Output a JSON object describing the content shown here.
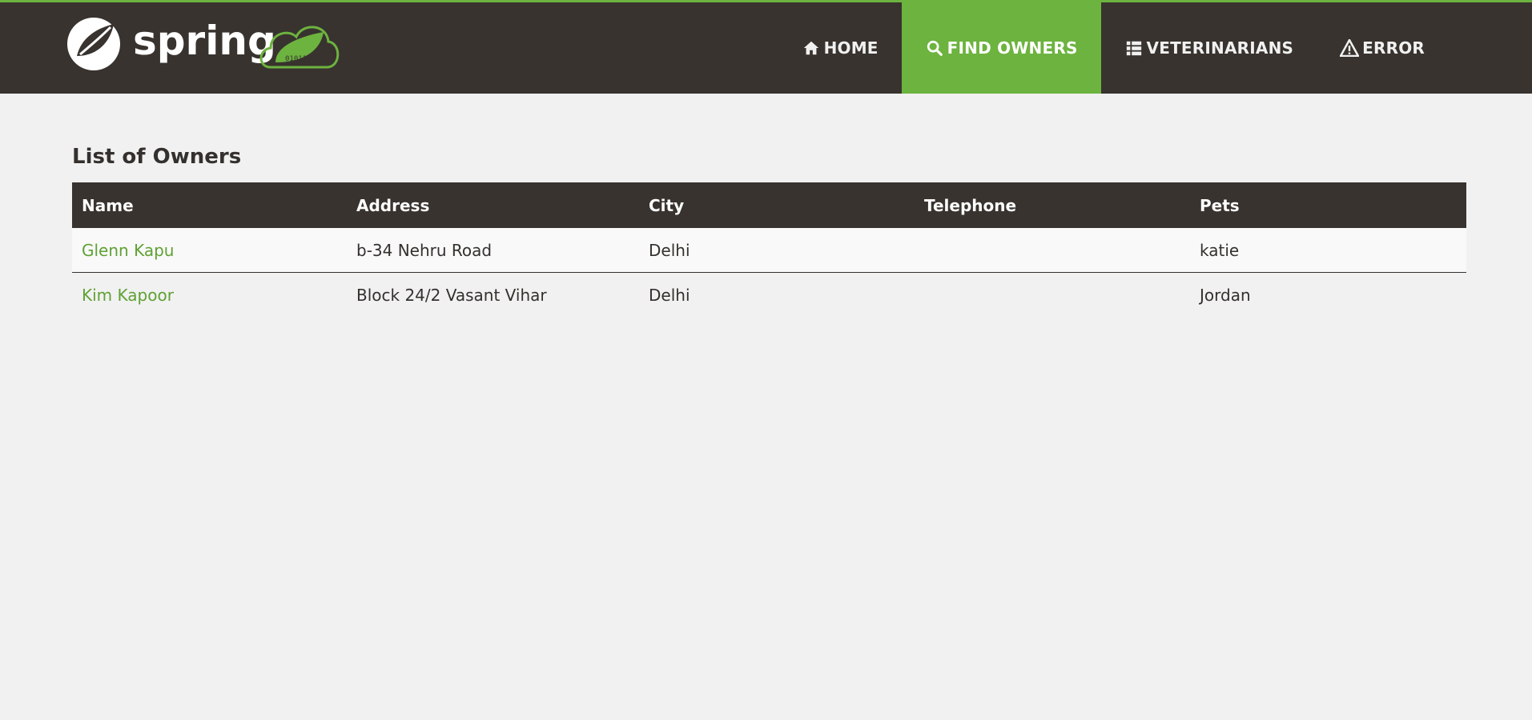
{
  "brand": {
    "logo_text": "spring",
    "logo_cloud_text": "01011"
  },
  "nav": {
    "items": [
      {
        "label": "HOME",
        "icon": "home-icon",
        "active": false
      },
      {
        "label": "FIND OWNERS",
        "icon": "search-icon",
        "active": true
      },
      {
        "label": "VETERINARIANS",
        "icon": "list-icon",
        "active": false
      },
      {
        "label": "ERROR",
        "icon": "warning-icon",
        "active": false
      }
    ]
  },
  "page": {
    "title": "List of Owners"
  },
  "table": {
    "headers": [
      "Name",
      "Address",
      "City",
      "Telephone",
      "Pets"
    ],
    "rows": [
      {
        "name": "Glenn Kapu",
        "address": "b-34 Nehru Road",
        "city": "Delhi",
        "telephone": "",
        "pets": "katie"
      },
      {
        "name": "Kim Kapoor",
        "address": "Block 24/2 Vasant Vihar",
        "city": "Delhi",
        "telephone": "",
        "pets": "Jordan"
      }
    ]
  },
  "colors": {
    "navbar": "#38332f",
    "accent": "#6db33f",
    "link": "#5fa134",
    "background": "#f1f1f1"
  }
}
